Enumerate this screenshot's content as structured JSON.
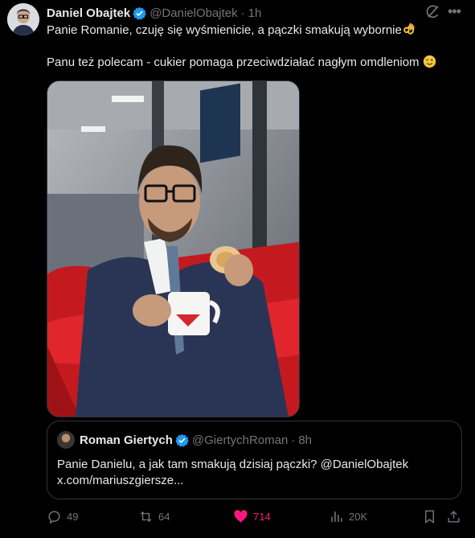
{
  "tweet": {
    "author_name": "Daniel Obajtek",
    "author_handle": "@DanielObajtek",
    "separator": "·",
    "time": "1h",
    "line1": "Panie Romanie, czuję się wyśmienicie, a pączki smakują wybornie",
    "line2": "Panu też polecam - cukier pomaga przeciwdziałać nagłym omdleniom"
  },
  "quote": {
    "author_name": "Roman Giertych",
    "author_handle": "@GiertychRoman",
    "separator": "·",
    "time": "8h",
    "line1": "Panie Danielu, a jak tam smakują dzisiaj pączki? @DanielObajtek",
    "line2": "x.com/mariuszgiersze..."
  },
  "actions": {
    "replies": "49",
    "reposts": "64",
    "likes": "714",
    "views": "20K"
  },
  "colors": {
    "background": "#000000",
    "text": "#e7e9ea",
    "muted": "#71767b",
    "border": "#2f3336",
    "like": "#f91880",
    "verified": "#1d9bf0"
  },
  "icons": [
    "verified-badge-icon",
    "grok-icon",
    "more-icon",
    "ok-hand-emoji",
    "wink-emoji",
    "reply-icon",
    "repost-icon",
    "like-icon",
    "views-icon",
    "bookmark-icon",
    "share-icon"
  ]
}
